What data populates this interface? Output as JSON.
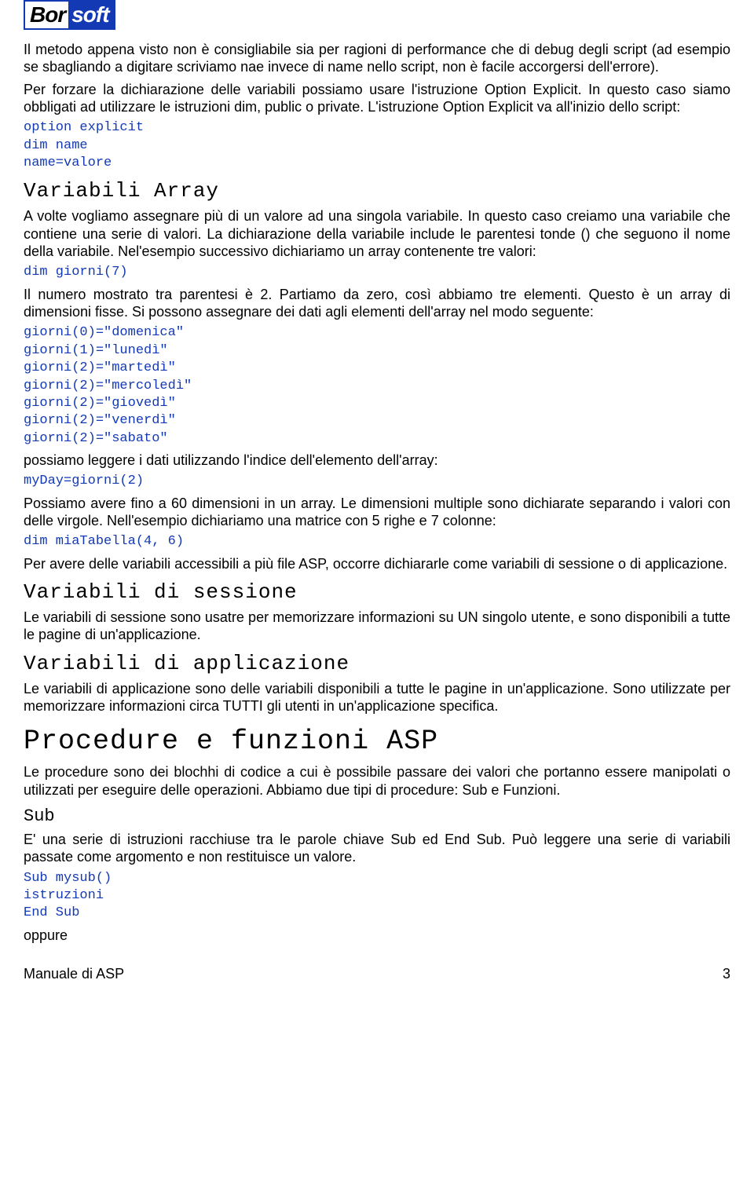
{
  "logo": {
    "left": "Bor",
    "right": "soft"
  },
  "p1": "Il metodo appena visto non è consigliabile sia per ragioni di performance che di debug degli script (ad esempio se sbagliando a digitare scriviamo nae invece di name nello script, non è facile accorgersi dell'errore).",
  "p2": "Per forzare la dichiarazione delle variabili possiamo usare l'istruzione Option Explicit. In questo caso siamo obbligati ad utilizzare le istruzioni dim, public o private. L'istruzione Option Explicit va all'inizio dello script:",
  "code1": [
    "option explicit",
    "dim name",
    "name=valore"
  ],
  "h2_array": "Variabili Array",
  "p3": "A volte vogliamo assegnare più di un valore ad una singola variabile. In questo caso creiamo una variabile che contiene una serie di valori. La dichiarazione della variabile include le parentesi tonde () che seguono il nome della variabile. Nel'esempio successivo dichiariamo un array contenente tre valori:",
  "code2": [
    "dim giorni(7)"
  ],
  "p4": "Il numero mostrato tra parentesi è 2. Partiamo da zero, così abbiamo tre elementi. Questo è un array di dimensioni fisse. Si possono assegnare dei dati agli elementi dell'array nel modo seguente:",
  "code3": [
    "giorni(0)=\"domenica\"",
    "giorni(1)=\"lunedì\"",
    "giorni(2)=\"martedì\"",
    "giorni(2)=\"mercoledì\"",
    "giorni(2)=\"giovedì\"",
    "giorni(2)=\"venerdì\"",
    "giorni(2)=\"sabato\""
  ],
  "p5": "possiamo leggere i dati utilizzando l'indice dell'elemento dell'array:",
  "code4": [
    "myDay=giorni(2)"
  ],
  "p6": "Possiamo avere fino a 60 dimensioni in un array. Le dimensioni multiple sono dichiarate separando i valori con delle virgole. Nell'esempio dichiariamo una matrice con 5 righe e 7 colonne:",
  "code5": [
    "dim miaTabella(4, 6)"
  ],
  "p7": "Per avere delle variabili accessibili a più file ASP, occorre dichiararle come variabili di sessione o di applicazione.",
  "h2_sessione": "Variabili di sessione",
  "p8": "Le variabili di sessione sono usatre per memorizzare informazioni su UN singolo utente, e sono disponibili a tutte le pagine di un'applicazione.",
  "h2_applicazione": "Variabili di applicazione",
  "p9": "Le variabili di applicazione sono delle variabili disponibili a tutte le pagine in un'applicazione. Sono utilizzate per memorizzare informazioni circa TUTTI gli utenti in un'applicazione specifica.",
  "h1_procedure": "Procedure e funzioni ASP",
  "p10": "Le procedure sono dei blochhi di codice a cui è possibile passare dei valori che portanno essere manipolati o utilizzati per eseguire delle operazioni. Abbiamo due tipi di procedure: Sub e Funzioni.",
  "h3_sub": "Sub",
  "p11": "E' una serie di istruzioni racchiuse tra le parole chiave Sub ed End Sub. Può leggere una serie di variabili passate come argomento e non restituisce un valore.",
  "code6": [
    "Sub mysub()",
    "istruzioni",
    "End Sub"
  ],
  "p12": "oppure",
  "footer": {
    "left": "Manuale di ASP",
    "right": "3"
  }
}
